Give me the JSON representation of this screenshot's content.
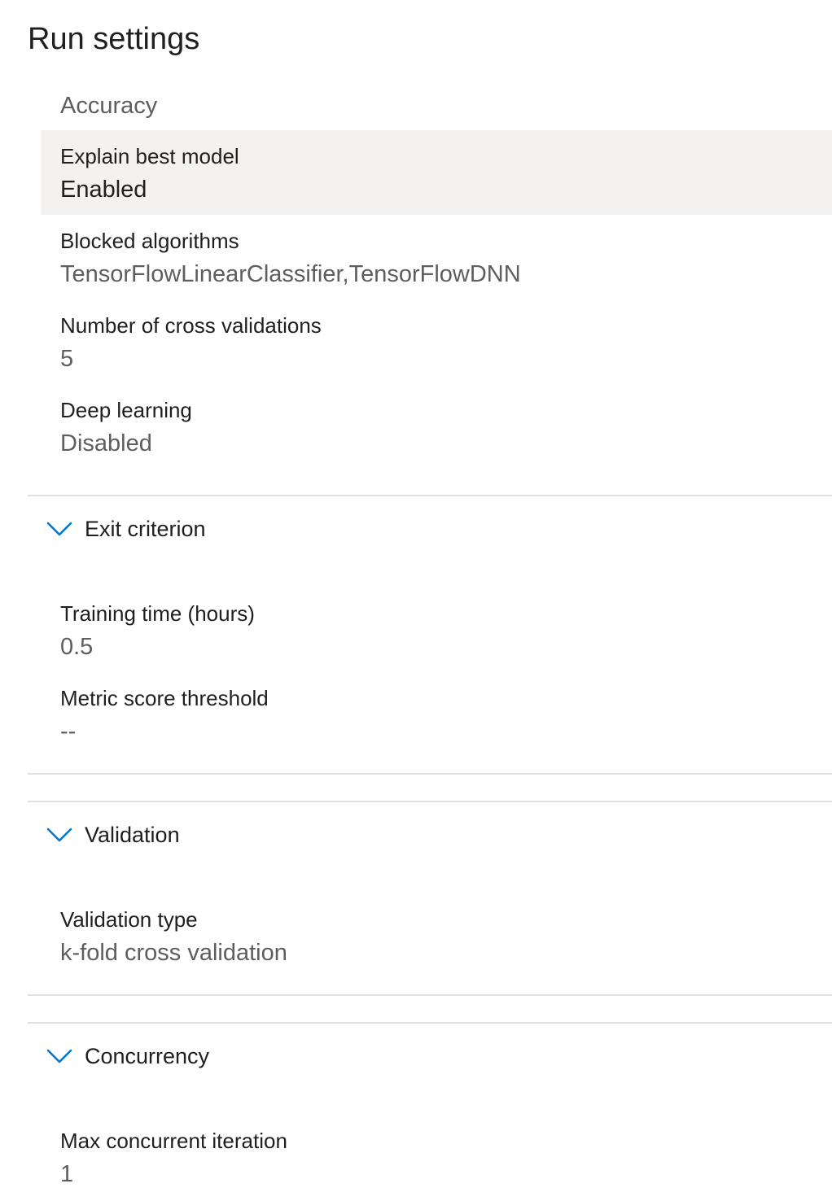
{
  "page": {
    "title": "Run settings"
  },
  "primary_metric": {
    "value": "Accuracy"
  },
  "settings": [
    {
      "label": "Explain best model",
      "value": "Enabled"
    },
    {
      "label": "Blocked algorithms",
      "value": "TensorFlowLinearClassifier,TensorFlowDNN"
    },
    {
      "label": "Number of cross validations",
      "value": "5"
    },
    {
      "label": "Deep learning",
      "value": "Disabled"
    }
  ],
  "exit_criterion": {
    "header": "Exit criterion",
    "icon": "chevron-down-icon",
    "items": [
      {
        "label": "Training time (hours)",
        "value": "0.5"
      },
      {
        "label": "Metric score threshold",
        "value": "--"
      }
    ]
  },
  "validation": {
    "header": "Validation",
    "icon": "chevron-down-icon",
    "items": [
      {
        "label": "Validation type",
        "value": "k-fold cross validation"
      }
    ]
  },
  "concurrency": {
    "header": "Concurrency",
    "icon": "chevron-down-icon",
    "items": [
      {
        "label": "Max concurrent iteration",
        "value": "1"
      }
    ]
  },
  "colors": {
    "accent": "#0078d4",
    "highlight_bg": "#f3f2f1",
    "divider": "#e1dfdd",
    "text_primary": "#201f1e",
    "text_secondary": "#605e5c"
  }
}
